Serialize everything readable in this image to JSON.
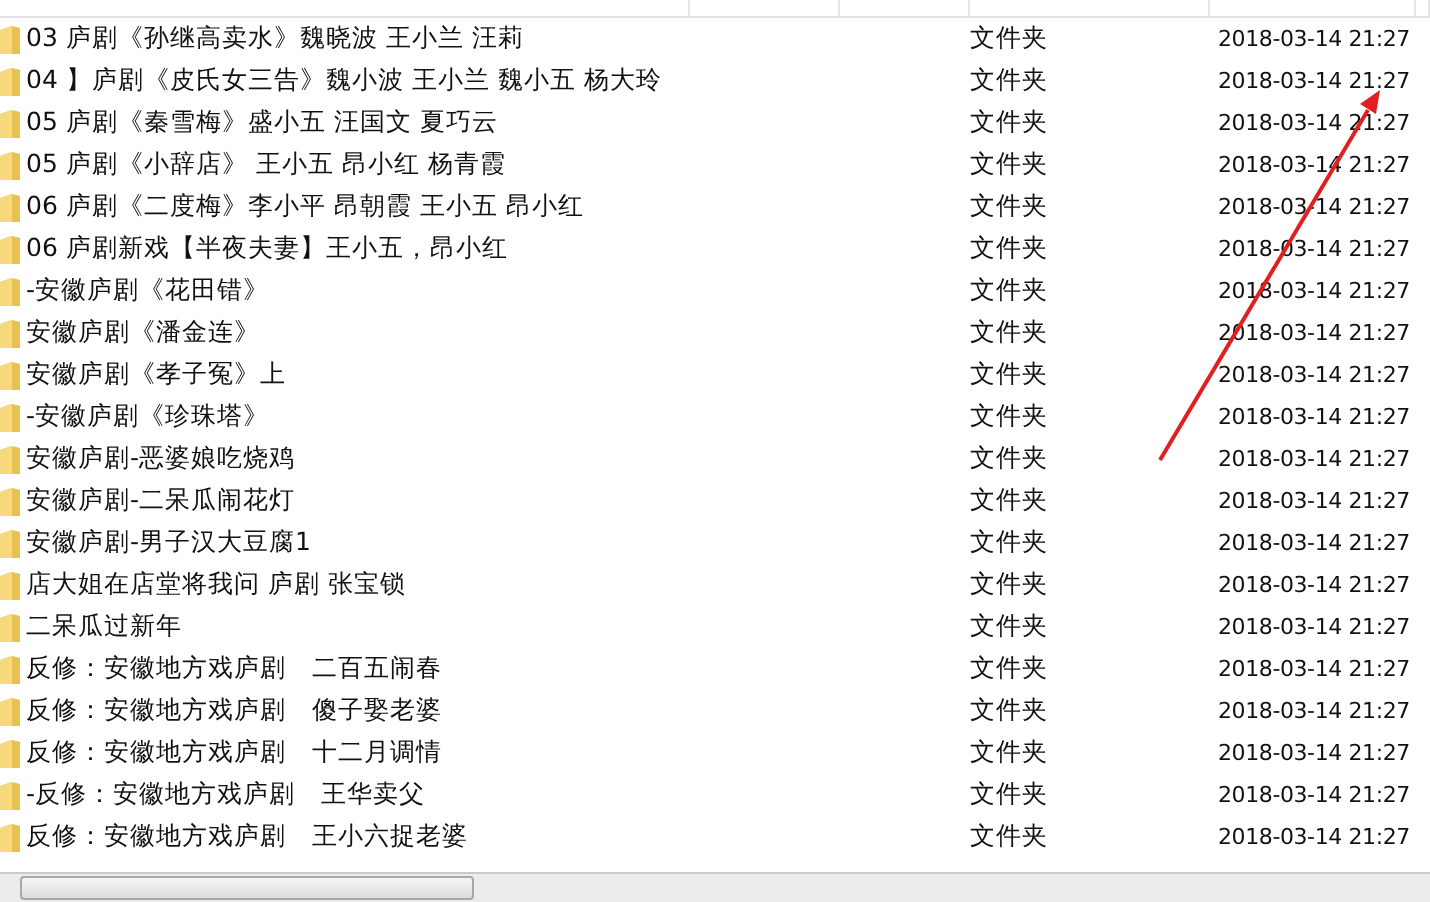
{
  "rows": [
    {
      "name": "03 庐剧《孙继高卖水》魏晓波 王小兰 汪莉",
      "type": "文件夹",
      "date": "2018-03-14 21:27"
    },
    {
      "name": "04 】庐剧《皮氏女三告》魏小波 王小兰 魏小五 杨大玲",
      "type": "文件夹",
      "date": "2018-03-14 21:27"
    },
    {
      "name": "05 庐剧《秦雪梅》盛小五 汪国文 夏巧云",
      "type": "文件夹",
      "date": "2018-03-14 21:27"
    },
    {
      "name": "05 庐剧《小辞店》 王小五 昂小红 杨青霞",
      "type": "文件夹",
      "date": "2018-03-14 21:27"
    },
    {
      "name": "06 庐剧《二度梅》李小平 昂朝霞 王小五 昂小红",
      "type": "文件夹",
      "date": "2018-03-14 21:27"
    },
    {
      "name": "06 庐剧新戏【半夜夫妻】王小五，昂小红",
      "type": "文件夹",
      "date": "2018-03-14 21:27"
    },
    {
      "name": "-安徽庐剧《花田错》",
      "type": "文件夹",
      "date": "2018-03-14 21:27"
    },
    {
      "name": "安徽庐剧《潘金连》",
      "type": "文件夹",
      "date": "2018-03-14 21:27"
    },
    {
      "name": "安徽庐剧《孝子冤》上",
      "type": "文件夹",
      "date": "2018-03-14 21:27"
    },
    {
      "name": "-安徽庐剧《珍珠塔》",
      "type": "文件夹",
      "date": "2018-03-14 21:27"
    },
    {
      "name": "安徽庐剧-恶婆娘吃烧鸡",
      "type": "文件夹",
      "date": "2018-03-14 21:27"
    },
    {
      "name": "安徽庐剧-二呆瓜闹花灯",
      "type": "文件夹",
      "date": "2018-03-14 21:27"
    },
    {
      "name": "安徽庐剧-男子汉大豆腐1",
      "type": "文件夹",
      "date": "2018-03-14 21:27"
    },
    {
      "name": "店大姐在店堂将我问 庐剧 张宝锁",
      "type": "文件夹",
      "date": "2018-03-14 21:27"
    },
    {
      "name": "二呆瓜过新年",
      "type": "文件夹",
      "date": "2018-03-14 21:27"
    },
    {
      "name": "反修：安徽地方戏庐剧　二百五闹春",
      "type": "文件夹",
      "date": "2018-03-14 21:27"
    },
    {
      "name": "反修：安徽地方戏庐剧　傻子娶老婆",
      "type": "文件夹",
      "date": "2018-03-14 21:27"
    },
    {
      "name": "反修：安徽地方戏庐剧　十二月调情",
      "type": "文件夹",
      "date": "2018-03-14 21:27"
    },
    {
      "name": "-反修：安徽地方戏庐剧　王华卖父",
      "type": "文件夹",
      "date": "2018-03-14 21:27"
    },
    {
      "name": "反修：安徽地方戏庐剧　王小六捉老婆",
      "type": "文件夹",
      "date": "2018-03-14 21:27"
    }
  ]
}
